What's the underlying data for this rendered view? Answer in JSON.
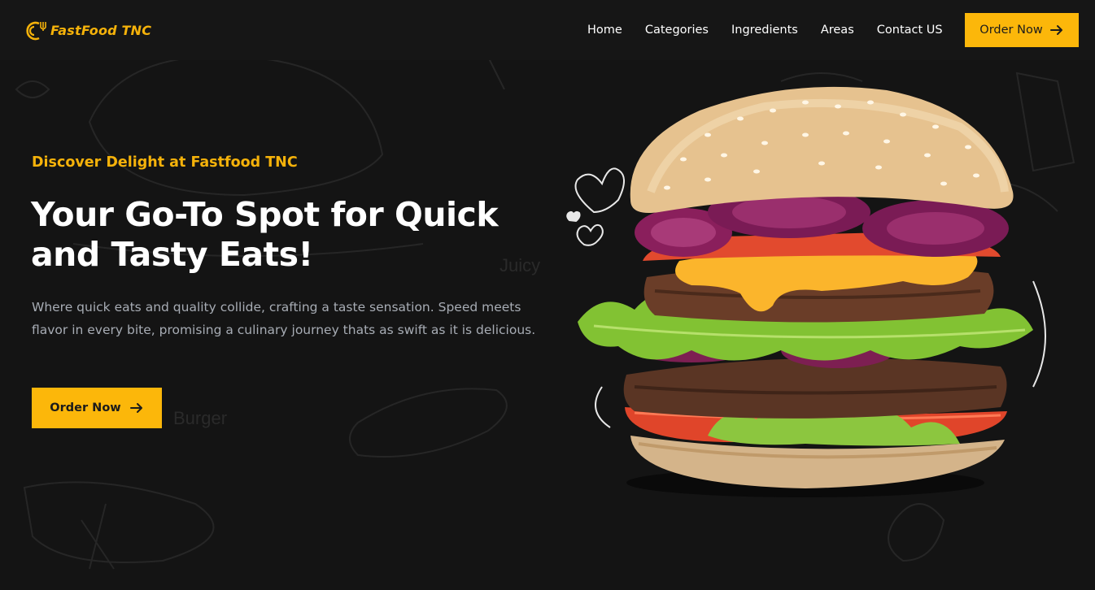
{
  "brand": {
    "name": "FastFood TNC",
    "icon": "cup-fork-logo-icon",
    "accent_color": "#f5b20a"
  },
  "nav": {
    "links": [
      {
        "label": "Home"
      },
      {
        "label": "Categories"
      },
      {
        "label": "Ingredients"
      },
      {
        "label": "Areas"
      },
      {
        "label": "Contact US"
      }
    ],
    "order_button": {
      "label": "Order Now",
      "icon": "arrow-right-icon"
    }
  },
  "hero": {
    "kicker": "Discover Delight at Fastfood TNC",
    "title": "Your Go-To Spot for Quick and Tasty Eats!",
    "description": "Where quick eats and quality collide, crafting a taste sensation. Speed meets flavor in every bite, promising a culinary journey thats as swift as it is delicious.",
    "order_button": {
      "label": "Order Now",
      "icon": "arrow-right-icon"
    },
    "image": "burger-image"
  },
  "background": {
    "words": [
      "Juicy",
      "Burger"
    ]
  },
  "colors": {
    "background": "#141414",
    "navbar": "#161616",
    "button": "#fcb70a",
    "text": "#ffffff",
    "muted": "#a7acb4"
  }
}
